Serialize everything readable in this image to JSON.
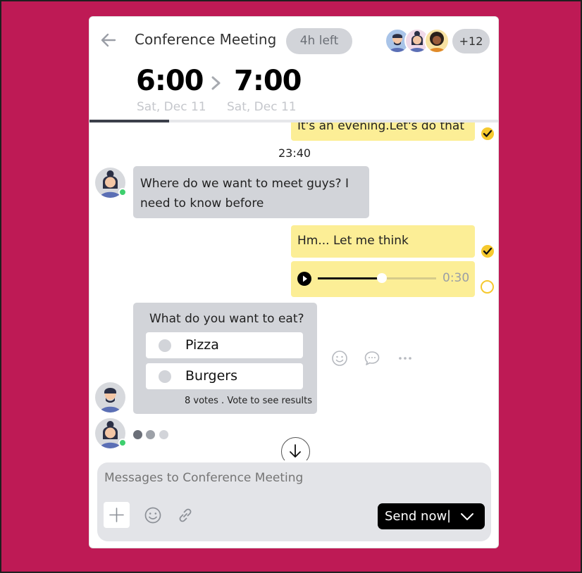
{
  "header": {
    "title": "Conference Meeting",
    "time_left": "4h left",
    "participants_more": "+12",
    "start_time": "6:00",
    "start_date": "Sat, Dec 11",
    "end_time": "7:00",
    "end_date": "Sat, Dec 11",
    "progress": 0.195
  },
  "messages": {
    "partial_text": "It's an evening.Let's do that",
    "timestamp": "23:40",
    "incoming_1": "Where do we want to meet guys? I need to know before",
    "outgoing_1": "Hm... Let me think",
    "audio_duration": "0:30",
    "audio_progress": 0.54
  },
  "poll": {
    "question": "What do you want to eat?",
    "options": [
      {
        "label": "Pizza"
      },
      {
        "label": "Burgers"
      }
    ],
    "footer": "8 votes . Vote to see results"
  },
  "composer": {
    "placeholder": "Messages to Conference Meeting",
    "send_label": "Send now",
    "separator": "|"
  },
  "colors": {
    "page_bg": "#be1a55",
    "outgoing_bubble": "#fcee96",
    "incoming_bubble": "#d2d4d9",
    "check": "#f6c92e",
    "online": "#3ecf6e",
    "send_button": "#000000"
  },
  "icons": [
    "back-arrow-icon",
    "chevron-right-icon",
    "check-icon",
    "play-icon",
    "smiley-icon",
    "comment-icon",
    "more-dots-icon",
    "arrow-down-icon",
    "plus-icon",
    "emoji-icon",
    "link-icon",
    "chevron-down-icon"
  ]
}
